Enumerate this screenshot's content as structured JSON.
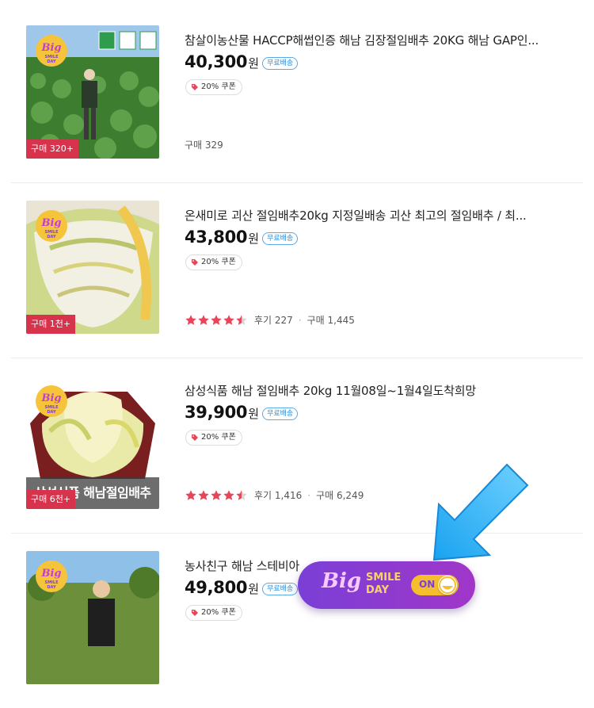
{
  "products": [
    {
      "title": "참살이농산물 HACCP해썹인증 해남 김장절임배추 20KG 해남 GAP인...",
      "price": "40,300",
      "currency": "원",
      "free_shipping": "무료배송",
      "coupon": "20% 쿠폰",
      "purchase_badge": "구매 320+",
      "logo_big": "Big",
      "logo_sub": "SMILE DAY",
      "rating": 0,
      "reviews": "",
      "purchases": "구매 329"
    },
    {
      "title": "온새미로 괴산 절임배추20kg 지정일배송 괴산 최고의 절임배추 / 최...",
      "price": "43,800",
      "currency": "원",
      "free_shipping": "무료배송",
      "coupon": "20% 쿠폰",
      "purchase_badge": "구매 1천+",
      "logo_big": "Big",
      "logo_sub": "SMILE DAY",
      "rating": 4.5,
      "reviews": "후기 227",
      "purchases": "구매 1,445"
    },
    {
      "title": "삼성식품 해남 절임배추 20kg 11월08일~1월4일도착희망",
      "price": "39,900",
      "currency": "원",
      "free_shipping": "무료배송",
      "coupon": "20% 쿠폰",
      "purchase_badge": "구매 6천+",
      "thumb_caption": "삼성식품 해남절임배추",
      "logo_big": "Big",
      "logo_sub": "SMILE DAY",
      "rating": 4.5,
      "reviews": "후기 1,416",
      "purchases": "구매 6,249"
    },
    {
      "title": "농사친구 해남 스테비아",
      "price": "49,800",
      "currency": "원",
      "free_shipping": "무료배송",
      "coupon": "20% 쿠폰",
      "logo_big": "Big",
      "logo_sub": "SMILE DAY"
    }
  ],
  "toggle": {
    "big": "Big",
    "smile": "SMILE",
    "day": "DAY",
    "state": "ON"
  },
  "colors": {
    "badge": "#d8334c",
    "star": "#e8455b",
    "accent_blue": "#2a8bd8",
    "toggle_bg": "#8b3ad0"
  }
}
